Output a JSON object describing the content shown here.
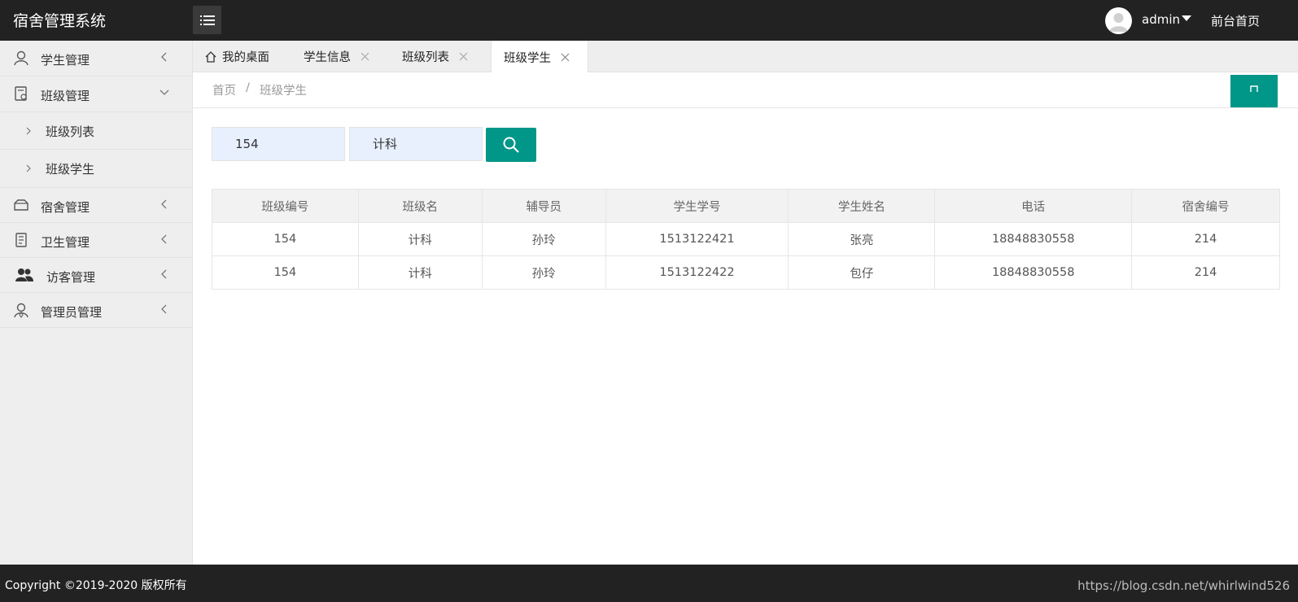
{
  "header": {
    "title": "宿舍管理系统",
    "username": "admin",
    "front_link": "前台首页"
  },
  "sidebar": {
    "items": [
      {
        "label": "学生管理",
        "icon": "user-icon",
        "expanded": false
      },
      {
        "label": "班级管理",
        "icon": "class-icon",
        "expanded": true,
        "children": [
          {
            "label": "班级列表"
          },
          {
            "label": "班级学生"
          }
        ]
      },
      {
        "label": "宿舍管理",
        "icon": "dorm-icon",
        "expanded": false
      },
      {
        "label": "卫生管理",
        "icon": "hygiene-icon",
        "expanded": false
      },
      {
        "label": "访客管理",
        "icon": "visitors-icon",
        "expanded": false
      },
      {
        "label": "管理员管理",
        "icon": "admin-icon",
        "expanded": false
      }
    ]
  },
  "tabs": [
    {
      "label": "我的桌面",
      "icon": "home-icon",
      "closable": false,
      "active": false
    },
    {
      "label": "学生信息",
      "closable": true,
      "active": false
    },
    {
      "label": "班级列表",
      "closable": true,
      "active": false
    },
    {
      "label": "班级学生",
      "closable": true,
      "active": true
    }
  ],
  "breadcrumb": {
    "home": "首页",
    "separator": "/",
    "current": "班级学生"
  },
  "search": {
    "class_id_value": "154",
    "class_name_value": "计科"
  },
  "table": {
    "headers": [
      "班级编号",
      "班级名",
      "辅导员",
      "学生学号",
      "学生姓名",
      "电话",
      "宿舍编号"
    ],
    "rows": [
      [
        "154",
        "计科",
        "孙玲",
        "1513122421",
        "张亮",
        "18848830558",
        "214"
      ],
      [
        "154",
        "计科",
        "孙玲",
        "1513122422",
        "包仔",
        "18848830558",
        "214"
      ]
    ]
  },
  "footer": {
    "copyright": "Copyright ©2019-2020 版权所有",
    "watermark": "https://blog.csdn.net/whirlwind526"
  },
  "colors": {
    "accent": "#009688",
    "topbar": "#222222",
    "sidebar": "#eeeeee",
    "input_bg": "#e8f0fe"
  }
}
